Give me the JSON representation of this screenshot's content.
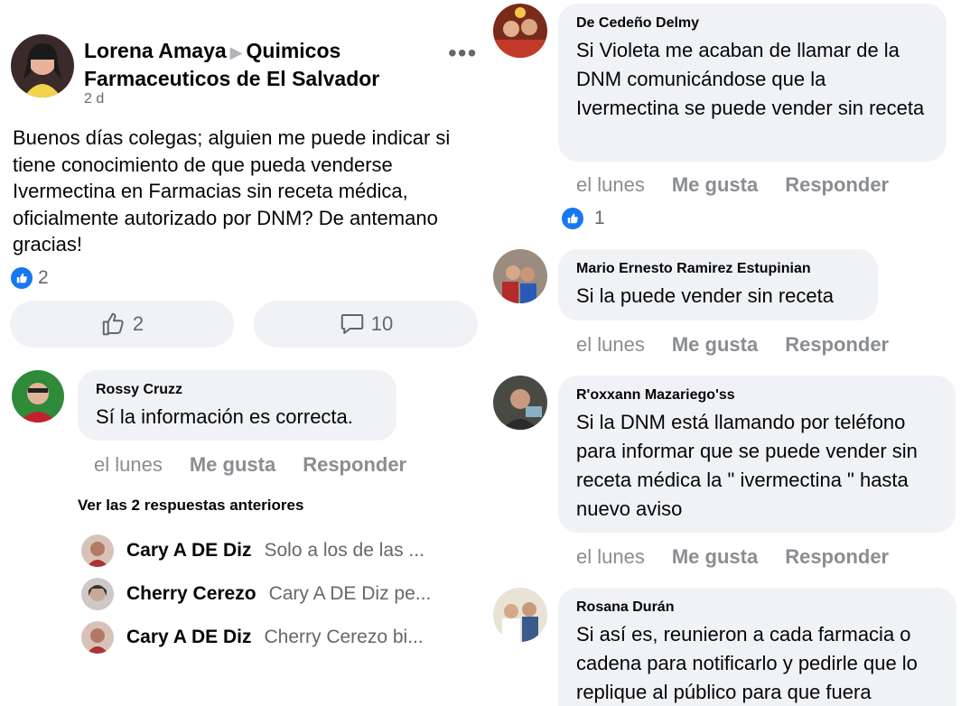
{
  "post": {
    "author": "Lorena Amaya",
    "group": "Quimicos Farmaceuticos de El Salvador",
    "time": "2 d",
    "text": "Buenos días colegas; alguien me puede indicar si tiene conocimiento de que pueda venderse Ivermectina en Farmacias sin receta médica, oficialmente autorizado por DNM? De antemano gracias!",
    "reaction_count": "2",
    "like_count": "2",
    "comment_count": "10"
  },
  "comments": [
    {
      "name": "Rossy Cruzz",
      "text": "Sí la información es correcta.",
      "time": "el lunes",
      "like": "Me gusta",
      "reply": "Responder"
    },
    {
      "name": "De Cedeño Delmy",
      "text": "Si Violeta me acaban de llamar de la DNM comunicándose que la Ivermectina se puede vender sin receta",
      "time": "el lunes",
      "like": "Me gusta",
      "reply": "Responder",
      "likes": "1"
    },
    {
      "name": "Mario Ernesto Ramirez Estupinian",
      "text": "Si la puede vender sin receta",
      "time": "el lunes",
      "like": "Me gusta",
      "reply": "Responder"
    },
    {
      "name": "R'oxxann Mazariego'ss",
      "text": "Si la DNM está llamando por teléfono para informar que se puede vender sin receta médica la \" ivermectina \" hasta nuevo aviso",
      "time": "el lunes",
      "like": "Me gusta",
      "reply": "Responder"
    },
    {
      "name": "Rosana Durán",
      "text": "Si así es, reunieron a cada farmacia o cadena para notificarlo y pedirle que lo replique al público para que fuera"
    }
  ],
  "replies_link": "Ver las 2 respuestas anteriores",
  "replies": [
    {
      "name": "Cary A DE Diz",
      "text": "Solo a los de las ..."
    },
    {
      "name": "Cherry Cerezo",
      "text": "Cary A DE Diz pe..."
    },
    {
      "name": "Cary A DE Diz",
      "text": "Cherry Cerezo bi..."
    }
  ],
  "colors": {
    "accent": "#1877f2",
    "bubble": "#f0f2f5",
    "muted": "#65676b"
  }
}
